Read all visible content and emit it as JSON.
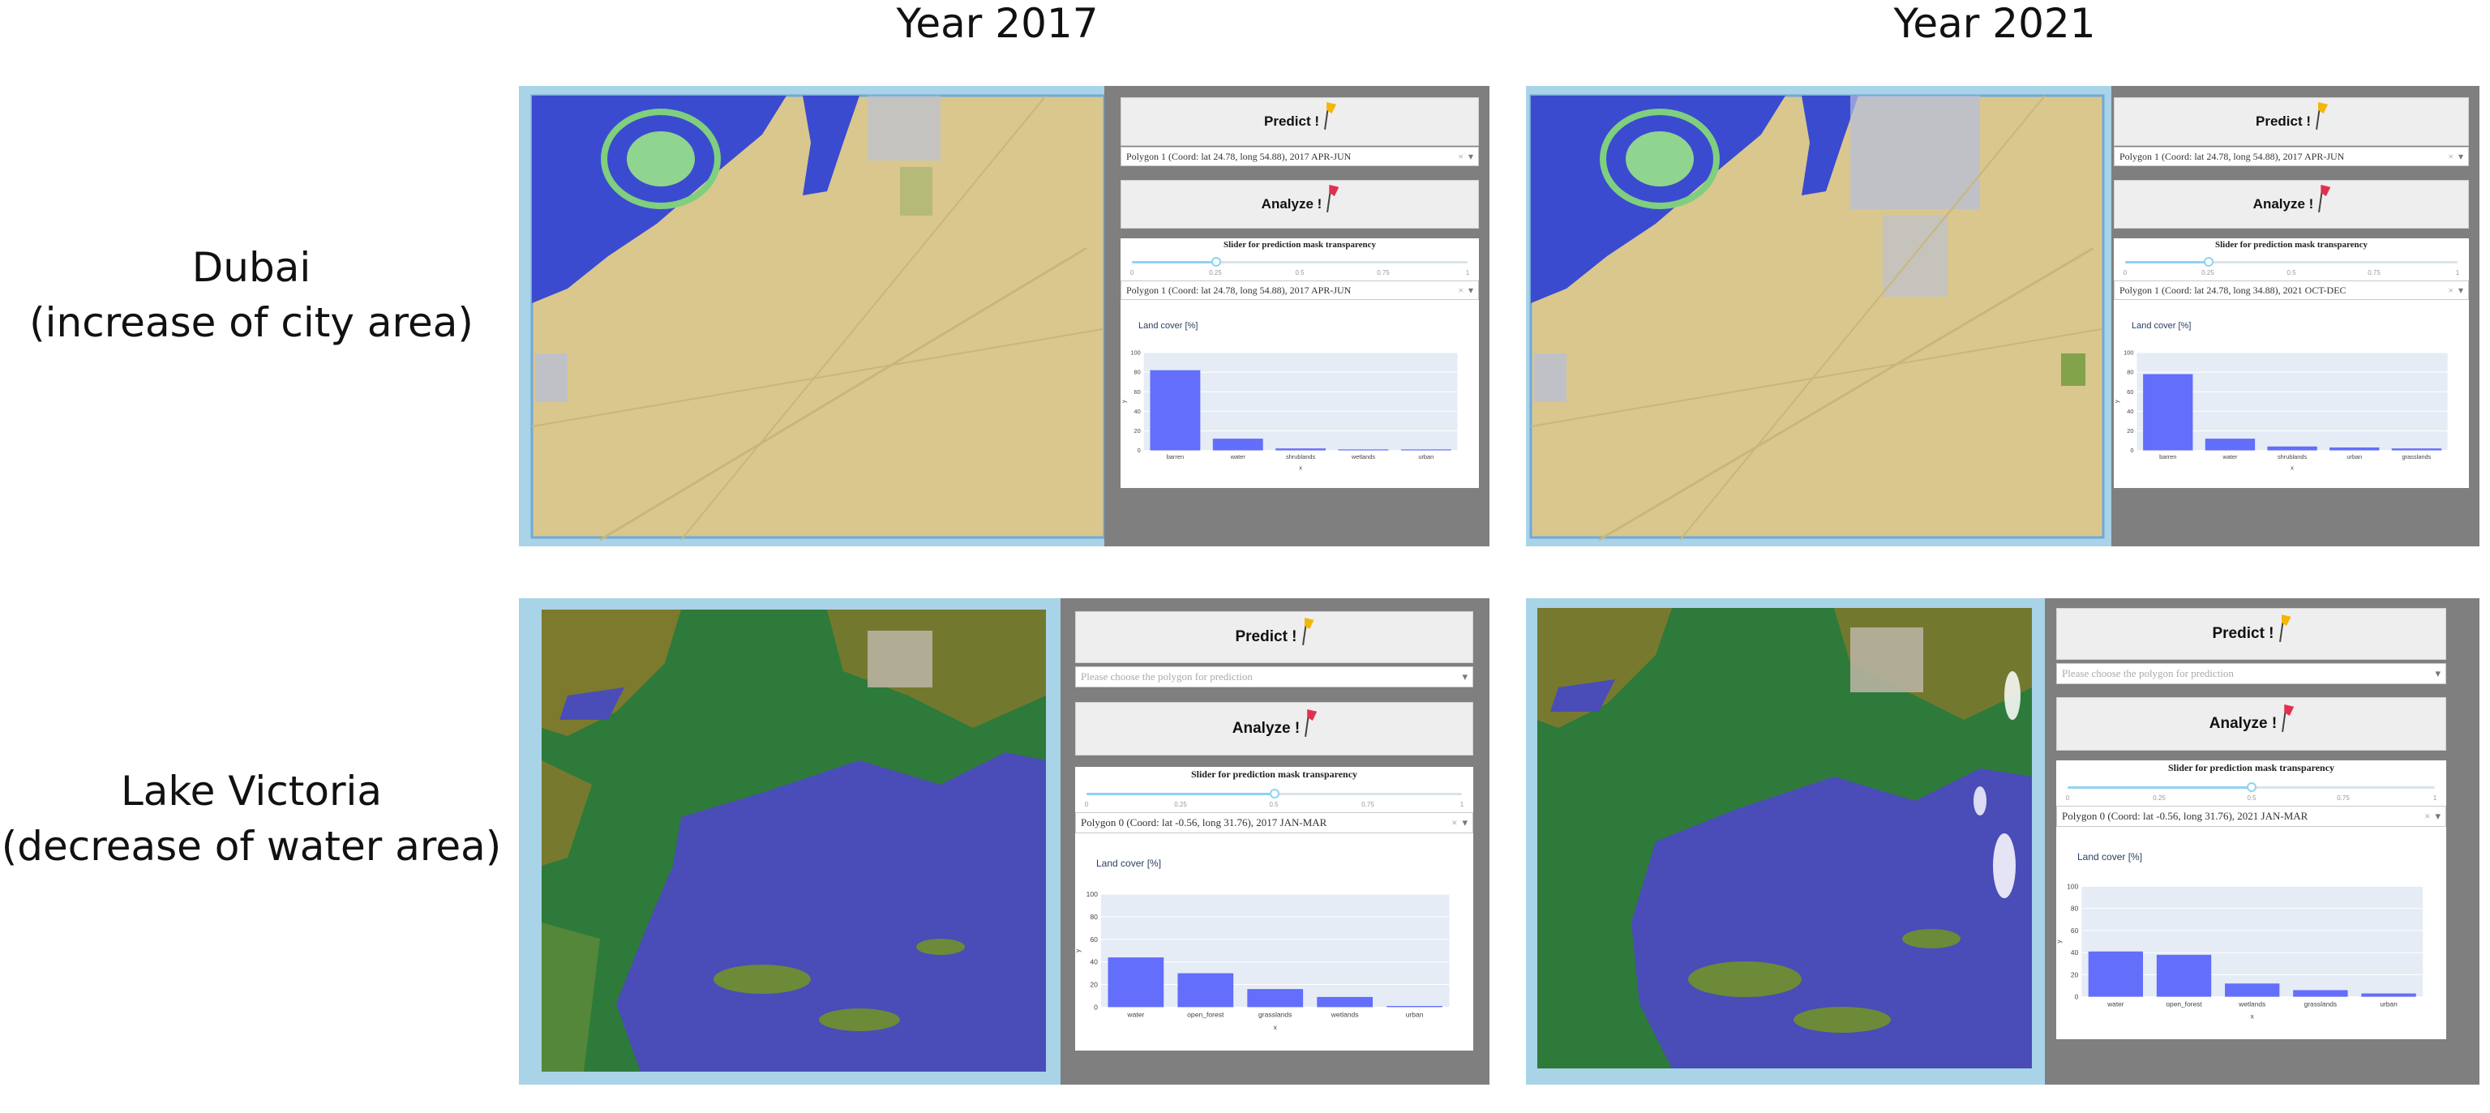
{
  "columns": {
    "left": "Year 2017",
    "right": "Year 2021"
  },
  "rows": {
    "dubai": {
      "line1": "Dubai",
      "line2": "(increase of city area)"
    },
    "victoria": {
      "line1": "Lake Victoria",
      "line2": "(decrease of water area)"
    }
  },
  "colors": {
    "barren": "#d9c78e",
    "water": "#3b4bcf",
    "urban": "#b5bfe0",
    "forest": "#2e7a3a",
    "grassland": "#8a7a2c",
    "bar": "#636efa",
    "panel": "#7f7f7f"
  },
  "icons": {
    "predict": "yellow-flag-icon",
    "analyze": "red-flag-icon"
  },
  "panels": [
    {
      "id": "dubai-2017",
      "predict_label": "Predict !",
      "analyze_label": "Analyze !",
      "dropdown1": "Polygon 1 (Coord: lat 24.78, long 54.88), 2017 APR-JUN",
      "dropdown1_placeholder": false,
      "slider_title": "Slider for prediction mask transparency",
      "slider_ticks": [
        "0",
        "0.25",
        "0.5",
        "0.75",
        "1"
      ],
      "slider_value": 0.25,
      "dropdown2": "Polygon 1 (Coord: lat 24.78, long 54.88), 2017 APR-JUN"
    },
    {
      "id": "dubai-2021",
      "predict_label": "Predict !",
      "analyze_label": "Analyze !",
      "dropdown1": "Polygon 1 (Coord: lat 24.78, long 54.88), 2017 APR-JUN",
      "dropdown1_placeholder": false,
      "slider_title": "Slider for prediction mask transparency",
      "slider_ticks": [
        "0",
        "0.25",
        "0.5",
        "0.75",
        "1"
      ],
      "slider_value": 0.25,
      "dropdown2": "Polygon 1 (Coord: lat 24.78, long 34.88), 2021 OCT-DEC"
    },
    {
      "id": "victoria-2017",
      "predict_label": "Predict !",
      "analyze_label": "Analyze !",
      "dropdown1": "Please choose the polygon for prediction",
      "dropdown1_placeholder": true,
      "slider_title": "Slider for prediction mask transparency",
      "slider_ticks": [
        "0",
        "0.25",
        "0.5",
        "0.75",
        "1"
      ],
      "slider_value": 0.5,
      "dropdown2": "Polygon 0 (Coord: lat -0.56, long 31.76), 2017 JAN-MAR"
    },
    {
      "id": "victoria-2021",
      "predict_label": "Predict !",
      "analyze_label": "Analyze !",
      "dropdown1": "Please choose the polygon for prediction",
      "dropdown1_placeholder": true,
      "slider_title": "Slider for prediction mask transparency",
      "slider_ticks": [
        "0",
        "0.25",
        "0.5",
        "0.75",
        "1"
      ],
      "slider_value": 0.5,
      "dropdown2": "Polygon 0 (Coord: lat -0.56, long 31.76), 2021 JAN-MAR"
    }
  ],
  "chart_data": [
    {
      "type": "bar",
      "title": "Land cover [%]",
      "xlabel": "x",
      "ylabel": "y",
      "ylim": [
        0,
        100
      ],
      "yticks": [
        "0",
        "20",
        "40",
        "60",
        "80",
        "100"
      ],
      "categories": [
        "barren",
        "water",
        "shrublands",
        "wetlands",
        "urban"
      ],
      "values": [
        82,
        12,
        2,
        1,
        1
      ]
    },
    {
      "type": "bar",
      "title": "Land cover [%]",
      "xlabel": "x",
      "ylabel": "y",
      "ylim": [
        0,
        100
      ],
      "yticks": [
        "0",
        "20",
        "40",
        "60",
        "80",
        "100"
      ],
      "categories": [
        "barren",
        "water",
        "shrublands",
        "urban",
        "grasslands"
      ],
      "values": [
        78,
        12,
        4,
        3,
        2
      ]
    },
    {
      "type": "bar",
      "title": "Land cover [%]",
      "xlabel": "x",
      "ylabel": "y",
      "ylim": [
        0,
        100
      ],
      "yticks": [
        "0",
        "20",
        "40",
        "60",
        "80",
        "100"
      ],
      "categories": [
        "water",
        "open_forest",
        "grasslands",
        "wetlands",
        "urban"
      ],
      "values": [
        44,
        30,
        16,
        9,
        1
      ]
    },
    {
      "type": "bar",
      "title": "Land cover [%]",
      "xlabel": "x",
      "ylabel": "y",
      "ylim": [
        0,
        100
      ],
      "yticks": [
        "0",
        "20",
        "40",
        "60",
        "80",
        "100"
      ],
      "categories": [
        "water",
        "open_forest",
        "wetlands",
        "grasslands",
        "urban"
      ],
      "values": [
        41,
        38,
        12,
        6,
        3
      ]
    }
  ]
}
